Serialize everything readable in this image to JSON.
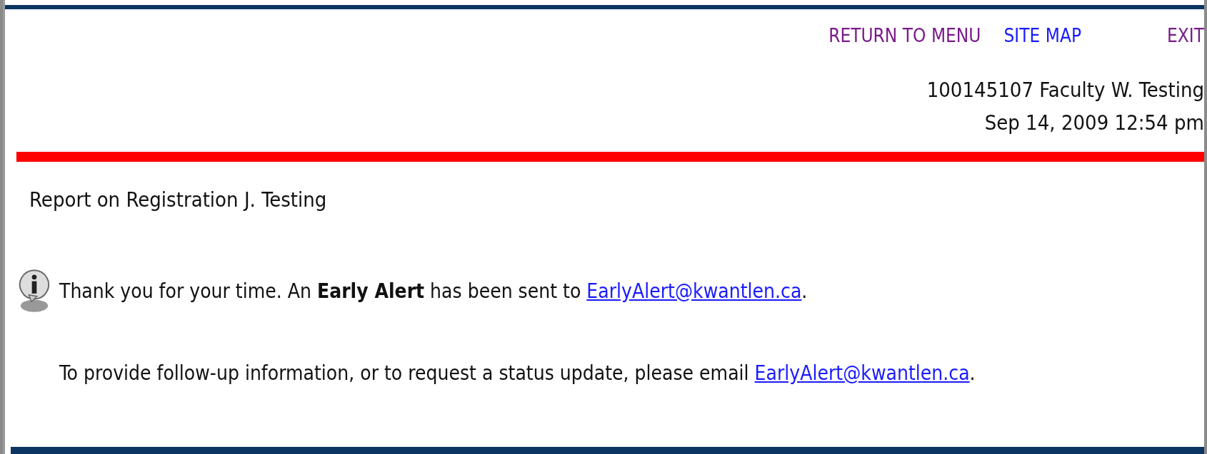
{
  "nav_links": [
    {
      "label": "RETURN TO MENU",
      "visited": true
    },
    {
      "label": "SITE MAP",
      "visited": false
    },
    {
      "label": "EXIT",
      "visited": true
    }
  ],
  "user": {
    "id_name": "100145107 Faculty W. Testing",
    "datetime": "Sep 14, 2009 12:54 pm"
  },
  "page_title": "Report on Registration J. Testing",
  "messages": [
    {
      "kind": "info",
      "before": "Thank you for your time. An **Early Alert** has been sent to ",
      "link": "EarlyAlert@kwantlen.ca",
      "after": "."
    },
    {
      "kind": "plain",
      "before": "To provide follow-up information, or to request a status update, please email ",
      "link": "EarlyAlert@kwantlen.ca",
      "after": "."
    }
  ]
}
